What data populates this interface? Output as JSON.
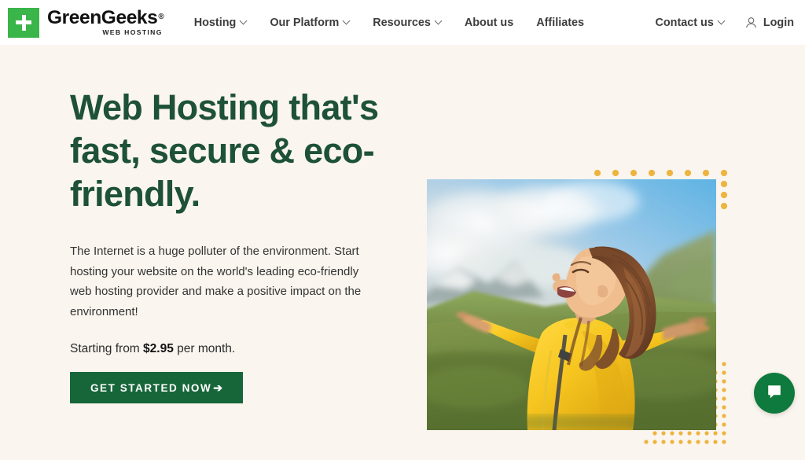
{
  "brand": {
    "name": "GreenGeeks",
    "registered_mark": "®",
    "tagline": "WEB HOSTING",
    "logo_icon": "green-plus-square-icon",
    "logo_color": "#3ab54a"
  },
  "header": {
    "background": "#ffffff",
    "nav": [
      {
        "label": "Hosting",
        "has_dropdown": true
      },
      {
        "label": "Our Platform",
        "has_dropdown": true
      },
      {
        "label": "Resources",
        "has_dropdown": true
      },
      {
        "label": "About us",
        "has_dropdown": false
      },
      {
        "label": "Affiliates",
        "has_dropdown": false
      }
    ],
    "contact": {
      "label": "Contact us",
      "has_dropdown": true
    },
    "login": {
      "label": "Login",
      "icon": "user-icon"
    }
  },
  "hero": {
    "background": "#faf5ee",
    "title": "Web Hosting that's fast, secure & eco-friendly.",
    "title_color": "#1d5138",
    "paragraph": "The Internet is a huge polluter of the environment. Start hosting your website on the world's leading eco-friendly web hosting provider and make a positive impact on the environment!",
    "price_prefix": "Starting from ",
    "price_value": "$2.95",
    "price_suffix": " per month.",
    "cta_label": "GET STARTED NOW",
    "cta_arrow": "➔",
    "cta_color": "#17663a",
    "image_alt": "Woman in yellow jacket with arms outstretched in green mountain landscape",
    "decoration_dot_color": "#edb440"
  },
  "chat": {
    "icon": "chat-bubble-icon",
    "color": "#0f7a3d"
  }
}
